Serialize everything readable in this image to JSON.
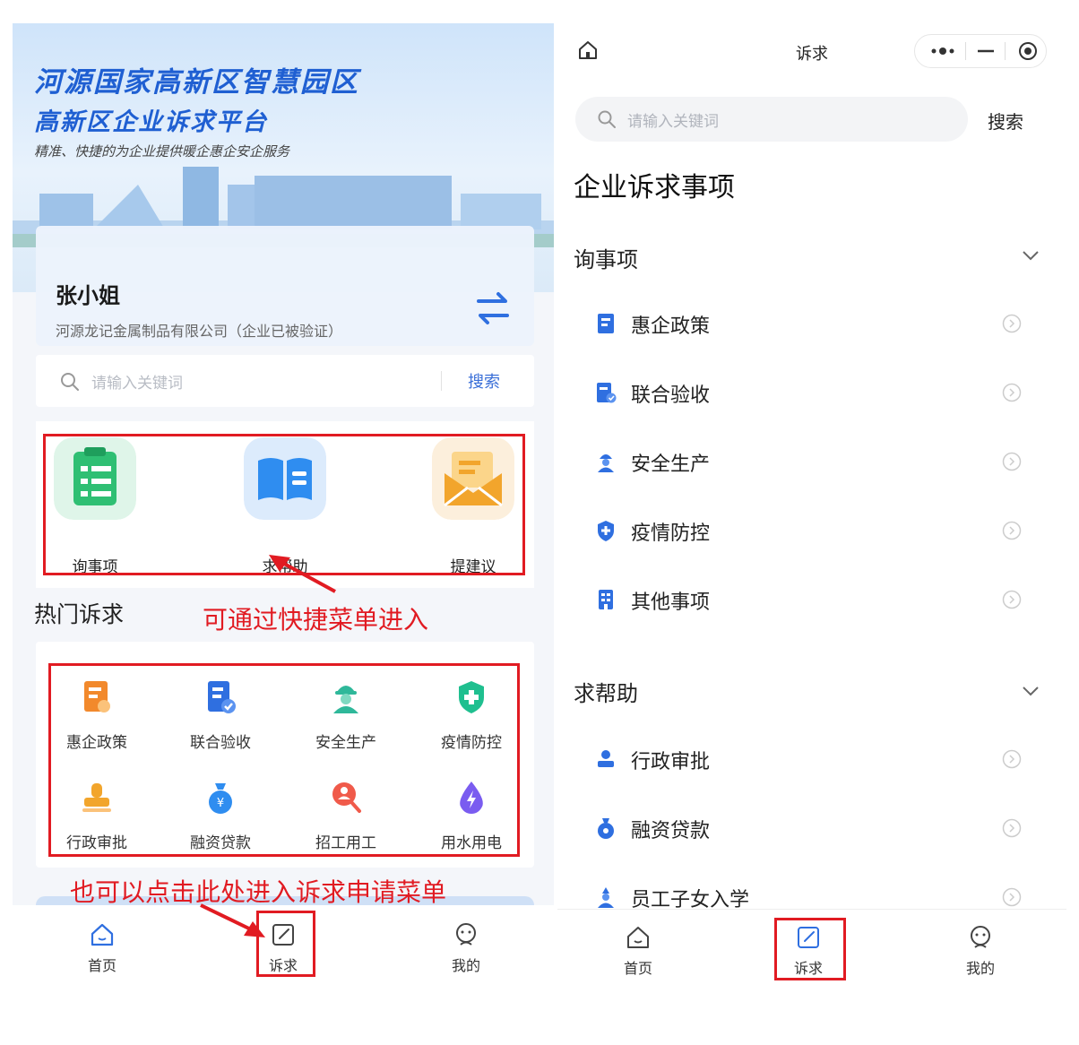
{
  "left": {
    "banner": {
      "title_line1": "河源国家高新区智慧园区",
      "title_line2": "高新区企业诉求平台",
      "subtitle": "精准、快捷的为企业提供暖企惠企安企服务"
    },
    "user": {
      "name": "张小姐",
      "company": "河源龙记金属制品有限公司（企业已被验证）"
    },
    "search": {
      "placeholder": "请输入关键词",
      "button": "搜索"
    },
    "quick_menu": [
      {
        "label": "询事项",
        "color": "#2fbf73"
      },
      {
        "label": "求帮助",
        "color": "#2f8df0"
      },
      {
        "label": "提建议",
        "color": "#f2a52c"
      }
    ],
    "hot_title": "热门诉求",
    "hot_items": [
      {
        "label": "惠企政策",
        "color": "#f2892c"
      },
      {
        "label": "联合验收",
        "color": "#2f6fe0"
      },
      {
        "label": "安全生产",
        "color": "#2fb89a"
      },
      {
        "label": "疫情防控",
        "color": "#1fbf8f"
      },
      {
        "label": "行政审批",
        "color": "#f2a52c"
      },
      {
        "label": "融资贷款",
        "color": "#2f8df0"
      },
      {
        "label": "招工用工",
        "color": "#f05a4a"
      },
      {
        "label": "用水用电",
        "color": "#7a5cf0"
      }
    ],
    "annotations": {
      "quick_hint": "可通过快捷菜单进入",
      "tab_hint": "也可以点击此处进入诉求申请菜单"
    },
    "tabs": [
      {
        "label": "首页"
      },
      {
        "label": "诉求"
      },
      {
        "label": "我的"
      }
    ]
  },
  "right": {
    "nav_title": "诉求",
    "search": {
      "placeholder": "请输入关键词",
      "button": "搜索"
    },
    "page_title": "企业诉求事项",
    "sections": [
      {
        "title": "询事项",
        "items": [
          {
            "label": "惠企政策"
          },
          {
            "label": "联合验收"
          },
          {
            "label": "安全生产"
          },
          {
            "label": "疫情防控"
          },
          {
            "label": "其他事项"
          }
        ]
      },
      {
        "title": "求帮助",
        "items": [
          {
            "label": "行政审批"
          },
          {
            "label": "融资贷款"
          },
          {
            "label": "员工子女入学"
          }
        ]
      }
    ],
    "tabs": [
      {
        "label": "首页"
      },
      {
        "label": "诉求"
      },
      {
        "label": "我的"
      }
    ]
  },
  "colors": {
    "accent_blue": "#3a6fd8",
    "annotation_red": "#e11b22",
    "icon_blue": "#2f6fe0"
  }
}
